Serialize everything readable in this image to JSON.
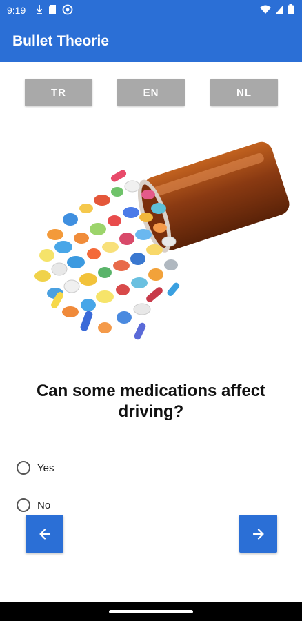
{
  "status_bar": {
    "time": "9:19"
  },
  "app_bar": {
    "title": "Bullet Theorie"
  },
  "languages": [
    {
      "label": "TR"
    },
    {
      "label": "EN"
    },
    {
      "label": "NL"
    }
  ],
  "question": {
    "text": "Can some medications affect driving?",
    "options": [
      {
        "label": "Yes",
        "selected": false
      },
      {
        "label": "No",
        "selected": false
      }
    ]
  },
  "nav": {
    "prev_icon": "arrow-left-icon",
    "next_icon": "arrow-right-icon"
  },
  "colors": {
    "primary": "#2b6fd6",
    "lang_button": "#a9a9a9"
  }
}
